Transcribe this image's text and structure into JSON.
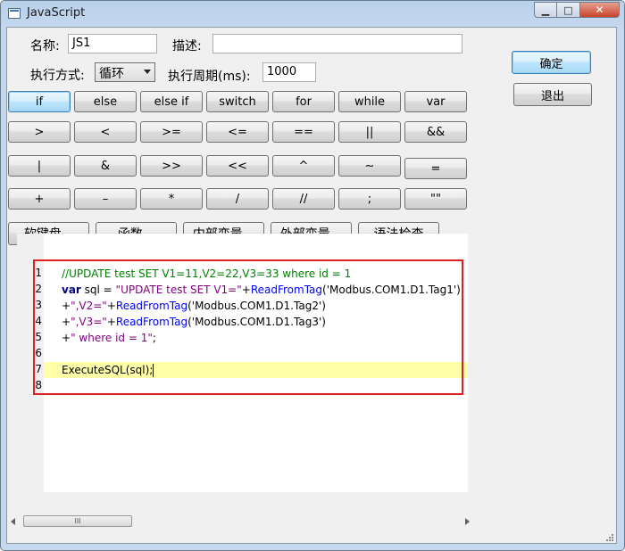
{
  "window": {
    "title": "JavaScript"
  },
  "caption": {
    "minimize": "▁",
    "maximize": "□",
    "close": "✕"
  },
  "form": {
    "name_label": "名称:",
    "name_value": "JS1",
    "desc_label": "描述:",
    "desc_value": "",
    "mode_label": "执行方式:",
    "mode_value": "循环",
    "period_label": "执行周期(ms):",
    "period_value": "1000"
  },
  "dialog_buttons": {
    "ok": "确定",
    "exit": "退出"
  },
  "keyword_rows": [
    [
      "if",
      "else",
      "else if",
      "switch",
      "for",
      "while",
      "var"
    ],
    [
      ">",
      "<",
      ">=",
      "<=",
      "==",
      "||",
      "&&"
    ],
    [
      "|",
      "&",
      ">>",
      "<<",
      "^",
      "~",
      "="
    ],
    [
      "+",
      "–",
      "*",
      "/",
      "//",
      ";",
      "\"\""
    ]
  ],
  "tool_buttons": [
    "软键盘...",
    "函数...",
    "内部变量...",
    "外部变量...",
    "语法检查"
  ],
  "editor": {
    "line_numbers": [
      "1",
      "2",
      "3",
      "4",
      "5",
      "6",
      "7",
      "8"
    ],
    "lines": [
      [
        {
          "t": "//UPDATE test SET V1=11,V2=22,V3=33 where id = 1",
          "c": "cm"
        }
      ],
      [
        {
          "t": "var",
          "c": "kw"
        },
        {
          "t": " sql = ",
          "c": "op"
        },
        {
          "t": "\"UPDATE test SET V1=\"",
          "c": "str"
        },
        {
          "t": "+",
          "c": "op"
        },
        {
          "t": "ReadFromTag",
          "c": "fn"
        },
        {
          "t": "(",
          "c": "op"
        },
        {
          "t": "'Modbus.COM1.D1.Tag1'",
          "c": "op"
        },
        {
          "t": ")",
          "c": "op"
        }
      ],
      [
        {
          "t": "+",
          "c": "op"
        },
        {
          "t": "\",V2=\"",
          "c": "str"
        },
        {
          "t": "+",
          "c": "op"
        },
        {
          "t": "ReadFromTag",
          "c": "fn"
        },
        {
          "t": "(",
          "c": "op"
        },
        {
          "t": "'Modbus.COM1.D1.Tag2'",
          "c": "op"
        },
        {
          "t": ")",
          "c": "op"
        }
      ],
      [
        {
          "t": "+",
          "c": "op"
        },
        {
          "t": "\",V3=\"",
          "c": "str"
        },
        {
          "t": "+",
          "c": "op"
        },
        {
          "t": "ReadFromTag",
          "c": "fn"
        },
        {
          "t": "(",
          "c": "op"
        },
        {
          "t": "'Modbus.COM1.D1.Tag3'",
          "c": "op"
        },
        {
          "t": ")",
          "c": "op"
        }
      ],
      [
        {
          "t": "+",
          "c": "op"
        },
        {
          "t": "\" where id = 1\"",
          "c": "str"
        },
        {
          "t": ";",
          "c": "op"
        }
      ],
      [],
      [
        {
          "t": "ExecuteSQL(sql);",
          "c": "op"
        }
      ],
      []
    ],
    "highlighted_line": 7
  },
  "scrollbar": {
    "thumb_grip": "III"
  }
}
